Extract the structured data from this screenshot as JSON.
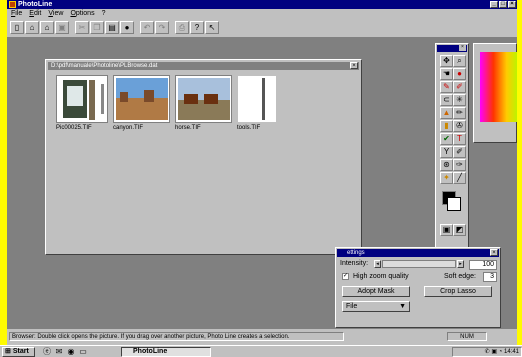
{
  "app": {
    "title": "PhotoLine"
  },
  "menu": [
    "File",
    "Edit",
    "View",
    "Options",
    "?"
  ],
  "browse": {
    "title": "D:\\pdf\\manuale\\Photoline\\PLBrowse.dat",
    "items": [
      {
        "name": "Pic00025.TIF"
      },
      {
        "name": "canyon.TIF"
      },
      {
        "name": "horse.TIF"
      },
      {
        "name": "tools.TIF"
      }
    ]
  },
  "settings": {
    "title": "ettings",
    "intensity_label": "Intensity:",
    "intensity_value": "100",
    "high_zoom_label": "High zoom quality",
    "soft_edge_label": "Soft edge:",
    "soft_edge_value": "3",
    "adopt_mask": "Adopt Mask",
    "crop_lasso": "Crop Lasso",
    "file_dropdown": "File"
  },
  "statusbar": {
    "message": "Browser: Double click opens the picture. If you drag over another picture, Photo Line creates a selection.",
    "num": "NUM"
  },
  "taskbar": {
    "start": "Start",
    "task": "PhotoLine",
    "clock": "14:41"
  }
}
